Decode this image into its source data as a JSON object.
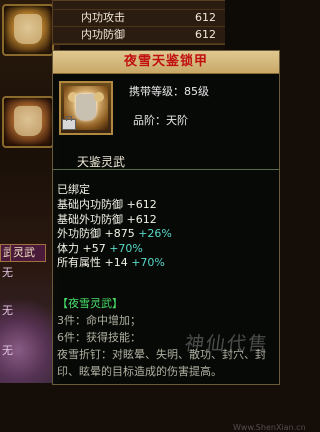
{
  "top_list": {
    "rows": [
      {
        "label": "内功攻击",
        "value": "612"
      },
      {
        "label": "内功防御",
        "value": "612"
      }
    ]
  },
  "side": {
    "tab_left": "武",
    "tab_right": "灵武",
    "chars": [
      "无",
      "无",
      "无"
    ]
  },
  "tooltip": {
    "title": "夜雪天鉴锁甲",
    "level": "携带等级：85级",
    "grade": "品阶：天阶",
    "subtitle": "天鉴灵武",
    "bound": "已绑定",
    "stats": [
      {
        "label": "基础内功防御",
        "value": "+612",
        "bonus": ""
      },
      {
        "label": "基础外功防御",
        "value": "+612",
        "bonus": ""
      },
      {
        "label": "外功防御",
        "value": "+875",
        "bonus": "+26%"
      },
      {
        "label": "体力",
        "value": "+57",
        "bonus": "+70%"
      },
      {
        "label": "所有属性",
        "value": "+14",
        "bonus": "+70%"
      }
    ],
    "set": {
      "name": "【夜雪灵武】",
      "piece3": "3件：命中增加；",
      "piece6": "6件：获得技能：",
      "skill": "夜雪折钉：对眩晕、失明、散功、封穴、封印、眩晕的目标造成的伤害提高。"
    },
    "watermark": "神仙代售",
    "watermark_sub": "Www.ShenXian.cn"
  },
  "colors": {
    "title_red": "#c01010",
    "bonus_cyan": "#58d8c8",
    "set_green": "#4ae068"
  }
}
